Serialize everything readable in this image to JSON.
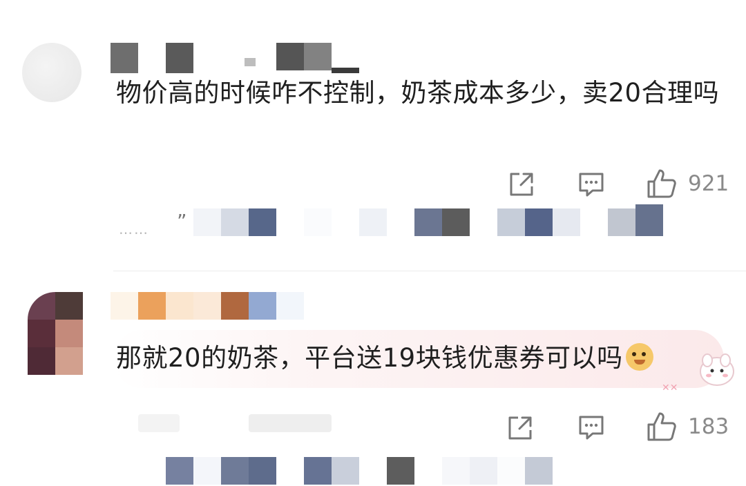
{
  "comments": [
    {
      "text": "物价高的时候咋不控制，奶茶成本多少，卖20合理吗",
      "like_count": "921"
    },
    {
      "text": "那就20的奶茶，平台送19块钱优惠券可以吗",
      "like_count": "183"
    }
  ],
  "reply_preview": {
    "ellipsis": "……",
    "quote_mark": "”"
  },
  "icons": {
    "share": "share-icon",
    "comment": "comment-icon",
    "like": "thumbs-up-icon",
    "emoji": "doge-emoji-icon"
  }
}
